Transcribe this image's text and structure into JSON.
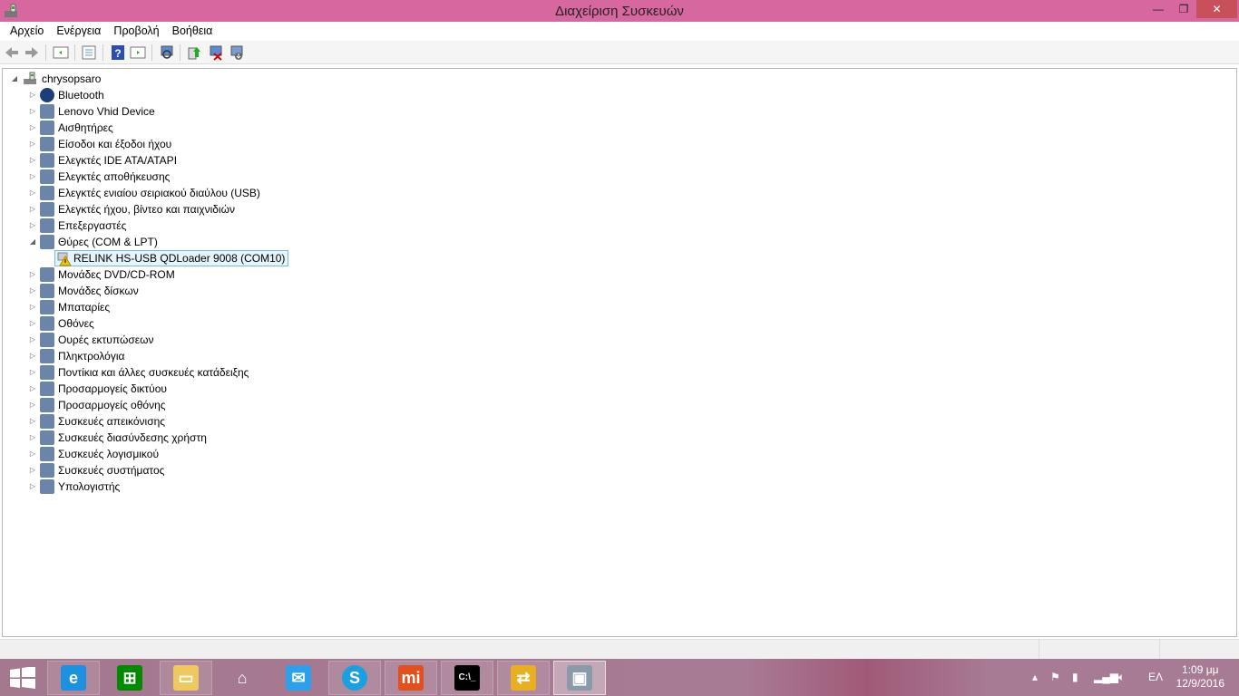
{
  "window": {
    "title": "Διαχείριση Συσκευών",
    "minimize": "—",
    "restore": "❐",
    "close": "✕"
  },
  "menu": [
    "Αρχείο",
    "Ενέργεια",
    "Προβολή",
    "Βοήθεια"
  ],
  "toolbar": {
    "icons": [
      "back-icon",
      "forward-icon",
      "show-hide-console-tree-icon",
      "properties-icon",
      "help-icon",
      "show-action-pane-icon",
      "scan-hardware-icon",
      "update-driver-icon",
      "uninstall-icon",
      "disable-icon"
    ]
  },
  "tree": {
    "root": "chrysopsaro",
    "categories": [
      {
        "label": "Bluetooth",
        "icon": "bluetooth-icon"
      },
      {
        "label": "Lenovo Vhid Device",
        "icon": "hid-icon"
      },
      {
        "label": "Αισθητήρες",
        "icon": "sensor-icon"
      },
      {
        "label": "Είσοδοι και έξοδοι ήχου",
        "icon": "speaker-icon"
      },
      {
        "label": "Ελεγκτές IDE ATA/ATAPI",
        "icon": "ide-icon"
      },
      {
        "label": "Ελεγκτές αποθήκευσης",
        "icon": "storage-icon"
      },
      {
        "label": "Ελεγκτές ενιαίου σειριακού διαύλου (USB)",
        "icon": "usb-icon"
      },
      {
        "label": "Ελεγκτές ήχου, βίντεο και παιχνιδιών",
        "icon": "sound-icon"
      },
      {
        "label": "Επεξεργαστές",
        "icon": "processor-icon"
      },
      {
        "label": "Θύρες (COM & LPT)",
        "icon": "port-icon",
        "expanded": true,
        "children": [
          {
            "label": "RELINK HS-USB QDLoader 9008 (COM10)",
            "icon": "warning-icon",
            "selected": true
          }
        ]
      },
      {
        "label": "Μονάδες DVD/CD-ROM",
        "icon": "dvd-icon"
      },
      {
        "label": "Μονάδες δίσκων",
        "icon": "disk-icon"
      },
      {
        "label": "Μπαταρίες",
        "icon": "battery-icon"
      },
      {
        "label": "Οθόνες",
        "icon": "monitor-icon"
      },
      {
        "label": "Ουρές εκτυπώσεων",
        "icon": "printer-icon"
      },
      {
        "label": "Πληκτρολόγια",
        "icon": "keyboard-icon"
      },
      {
        "label": "Ποντίκια και άλλες συσκευές κατάδειξης",
        "icon": "mouse-icon"
      },
      {
        "label": "Προσαρμογείς δικτύου",
        "icon": "network-icon"
      },
      {
        "label": "Προσαρμογείς οθόνης",
        "icon": "display-adapter-icon"
      },
      {
        "label": "Συσκευές απεικόνισης",
        "icon": "camera-icon"
      },
      {
        "label": "Συσκευές διασύνδεσης χρήστη",
        "icon": "hid-icon"
      },
      {
        "label": "Συσκευές λογισμικού",
        "icon": "software-device-icon"
      },
      {
        "label": "Συσκευές συστήματος",
        "icon": "system-icon"
      },
      {
        "label": "Υπολογιστής",
        "icon": "computer-icon"
      }
    ]
  },
  "taskbar": {
    "apps": [
      {
        "name": "internet-explorer",
        "color": "#1e90e0",
        "glyph": "e"
      },
      {
        "name": "store",
        "color": "#008a00",
        "glyph": "⊞"
      },
      {
        "name": "file-explorer",
        "color": "#f0c860",
        "glyph": "▭"
      },
      {
        "name": "home",
        "color": "#ffffff",
        "glyph": "⌂"
      },
      {
        "name": "mail",
        "color": "#2ca0e8",
        "glyph": "✉"
      },
      {
        "name": "skype",
        "color": "#1aa0e0",
        "glyph": "S"
      },
      {
        "name": "mi",
        "color": "#e2501e",
        "glyph": "mi"
      },
      {
        "name": "command-prompt",
        "color": "#000000",
        "glyph": "C:\\_"
      },
      {
        "name": "phone-tool",
        "color": "#e8b020",
        "glyph": "⇄"
      },
      {
        "name": "device-manager",
        "color": "#8a9aa8",
        "glyph": "▣",
        "active": true
      }
    ],
    "language": "ΕΛ",
    "time": "1:09 μμ",
    "date": "12/9/2016"
  }
}
